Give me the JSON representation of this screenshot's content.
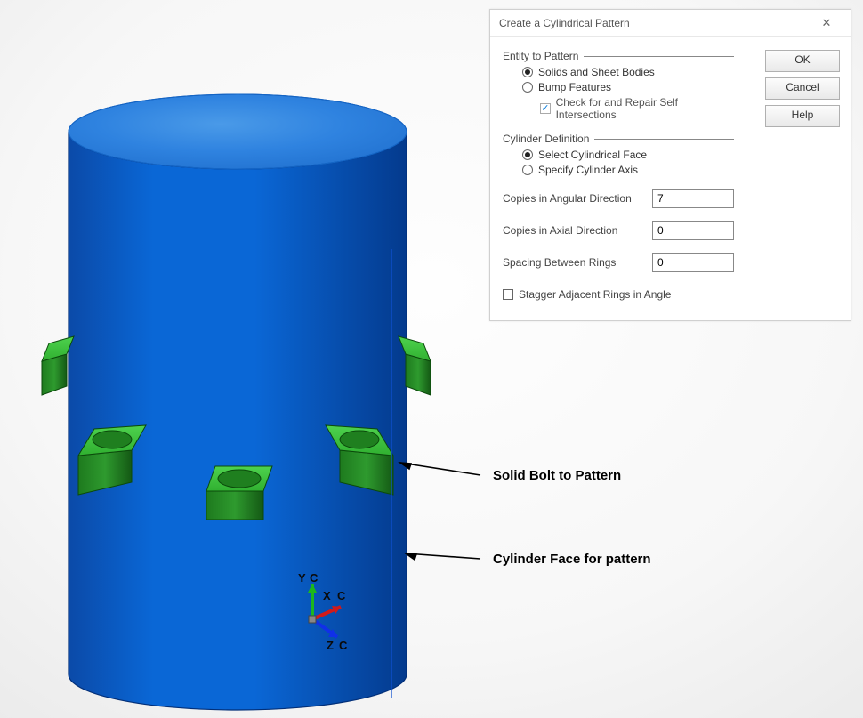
{
  "dialog": {
    "title": "Create a Cylindrical Pattern",
    "close_glyph": "✕",
    "buttons": {
      "ok": "OK",
      "cancel": "Cancel",
      "help": "Help"
    },
    "group_entity": {
      "title": "Entity to Pattern",
      "opt_solids": "Solids and Sheet Bodies",
      "opt_bump": "Bump Features",
      "chk_repair": "Check for and Repair Self Intersections"
    },
    "group_cylinder": {
      "title": "Cylinder Definition",
      "opt_face": "Select Cylindrical Face",
      "opt_axis": "Specify Cylinder Axis"
    },
    "fields": {
      "angular_label": "Copies in Angular Direction",
      "angular_value": "7",
      "axial_label": "Copies in Axial Direction",
      "axial_value": "0",
      "spacing_label": "Spacing Between Rings",
      "spacing_value": "0"
    },
    "stagger_label": "Stagger Adjacent Rings in Angle"
  },
  "annotations": {
    "bolt": "Solid Bolt to Pattern",
    "face": "Cylinder Face for pattern"
  },
  "triad": {
    "y": "Y",
    "x": "X",
    "z": "Z",
    "c": "C"
  }
}
